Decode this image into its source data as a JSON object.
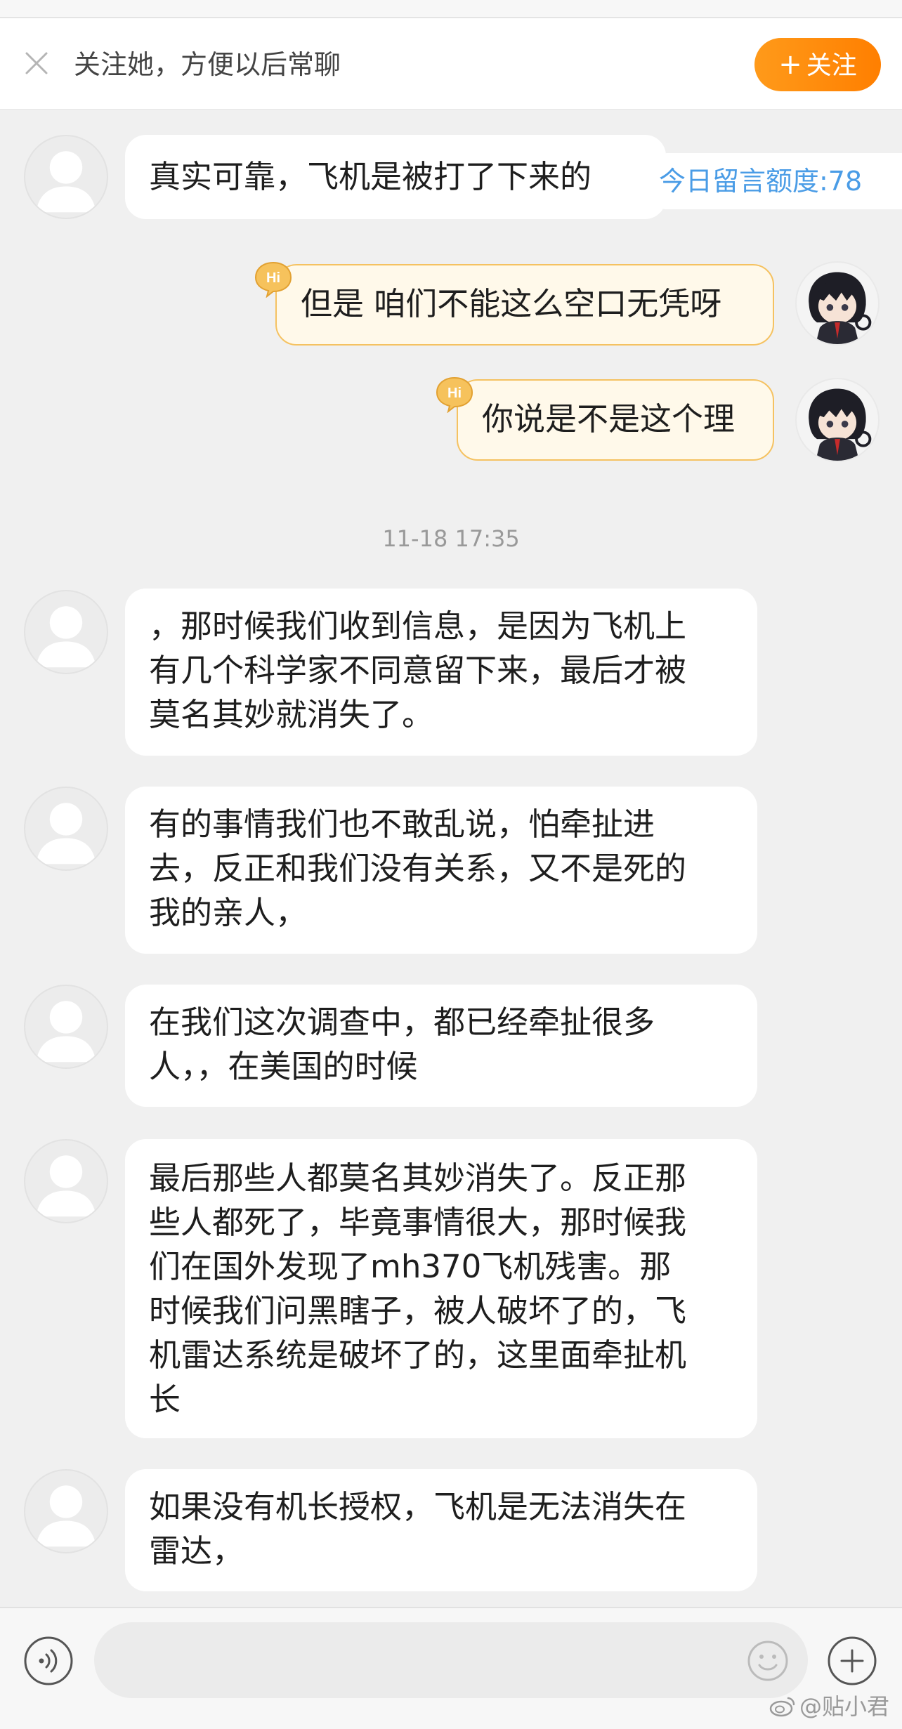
{
  "follow_bar": {
    "hint": "关注她，方便以后常聊",
    "follow_button": "关注",
    "close_icon": "close-icon"
  },
  "quota": "今日留言额度:78",
  "messages": [
    {
      "side": "them",
      "text": "真实可靠，飞机是被打了下来的"
    },
    {
      "side": "me",
      "text": "但是 咱们不能这么空口无凭呀"
    },
    {
      "side": "me",
      "text": "你说是不是这个理"
    },
    {
      "side": "them",
      "text": "，那时候我们收到信息，是因为飞机上\n有几个科学家不同意留下来，最后才被\n莫名其妙就消失了。"
    },
    {
      "side": "them",
      "text": "有的事情我们也不敢乱说，怕牵扯进\n去，反正和我们没有关系，又不是死的\n我的亲人，"
    },
    {
      "side": "them",
      "text": "在我们这次调查中，都已经牵扯很多\n人，，在美国的时候"
    },
    {
      "side": "them",
      "text": "最后那些人都莫名其妙消失了。反正那\n些人都死了，毕竟事情很大，那时候我\n们在国外发现了mh370飞机残害。那\n时候我们问黑瞎子，被人破坏了的，飞\n机雷达系统是破坏了的，这里面牵扯机\n长"
    },
    {
      "side": "them",
      "text": "如果没有机长授权，飞机是无法消失在\n雷达，"
    }
  ],
  "timestamp": "11-18 17:35",
  "badge_text": "Hi",
  "input_bar": {
    "placeholder": "",
    "icons": [
      "voice-icon",
      "emoji-icon",
      "plus-icon"
    ]
  },
  "watermark": "@贴小君",
  "colors": {
    "accent": "#ff8a00",
    "link": "#4a9ce6",
    "my_bubble_bg": "#fff9ea",
    "my_bubble_border": "#f5c261"
  }
}
